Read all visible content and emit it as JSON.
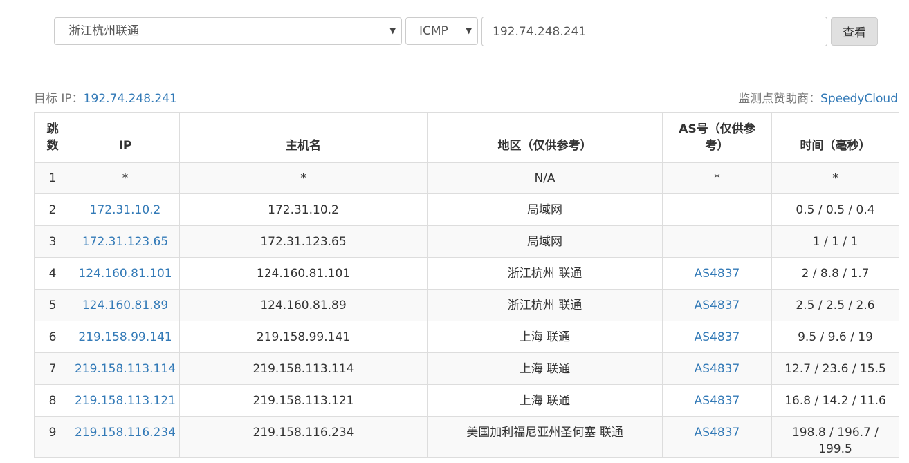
{
  "search": {
    "node_value": "浙江杭州联通",
    "protocol_value": "ICMP",
    "target_value": "192.74.248.241",
    "query_label": "查看"
  },
  "info": {
    "target_label": "目标 IP：",
    "target_ip": "192.74.248.241",
    "sponsor_label": "监测点赞助商：",
    "sponsor_name": "SpeedyCloud"
  },
  "table": {
    "headers": {
      "hop": "跳数",
      "ip": "IP",
      "hostname": "主机名",
      "region": "地区（仅供参考）",
      "as": "AS号（仅供参考）",
      "time": "时间（毫秒）"
    },
    "rows": [
      {
        "hop": "1",
        "ip": "*",
        "hostname": "*",
        "region": "N/A",
        "as": "*",
        "time": "*"
      },
      {
        "hop": "2",
        "ip": "172.31.10.2",
        "hostname": "172.31.10.2",
        "region": "局域网",
        "as": "",
        "time": "0.5 / 0.5 / 0.4"
      },
      {
        "hop": "3",
        "ip": "172.31.123.65",
        "hostname": "172.31.123.65",
        "region": "局域网",
        "as": "",
        "time": "1 / 1 / 1"
      },
      {
        "hop": "4",
        "ip": "124.160.81.101",
        "hostname": "124.160.81.101",
        "region": "浙江杭州 联通",
        "as": "AS4837",
        "time": "2 / 8.8 / 1.7"
      },
      {
        "hop": "5",
        "ip": "124.160.81.89",
        "hostname": "124.160.81.89",
        "region": "浙江杭州 联通",
        "as": "AS4837",
        "time": "2.5 / 2.5 / 2.6"
      },
      {
        "hop": "6",
        "ip": "219.158.99.141",
        "hostname": "219.158.99.141",
        "region": "上海 联通",
        "as": "AS4837",
        "time": "9.5 / 9.6 / 19"
      },
      {
        "hop": "7",
        "ip": "219.158.113.114",
        "hostname": "219.158.113.114",
        "region": "上海 联通",
        "as": "AS4837",
        "time": "12.7 / 23.6 / 15.5"
      },
      {
        "hop": "8",
        "ip": "219.158.113.121",
        "hostname": "219.158.113.121",
        "region": "上海 联通",
        "as": "AS4837",
        "time": "16.8 / 14.2 / 11.6"
      },
      {
        "hop": "9",
        "ip": "219.158.116.234",
        "hostname": "219.158.116.234",
        "region": "美国加利福尼亚州圣何塞 联通",
        "as": "AS4837",
        "time": "198.8 / 196.7 / 199.5"
      }
    ]
  }
}
